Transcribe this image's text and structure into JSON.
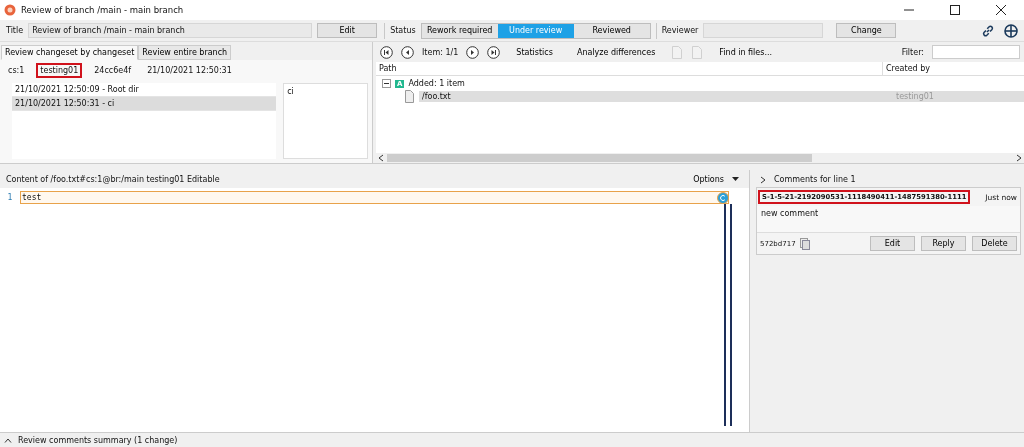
{
  "window": {
    "title": "Review of branch /main - main branch"
  },
  "toolbar": {
    "title_label": "Title",
    "title_value": "Review of branch /main - main branch",
    "edit_button": "Edit",
    "status_label": "Status",
    "status_options": [
      {
        "label": "Rework required",
        "selected": false
      },
      {
        "label": "Under review",
        "selected": true
      },
      {
        "label": "Reviewed",
        "selected": false
      }
    ],
    "reviewer_label": "Reviewer",
    "change_button": "Change"
  },
  "changeset_panel": {
    "tabs": [
      {
        "label": "Review changeset by changeset",
        "selected": true
      },
      {
        "label": "Review entire branch",
        "selected": false
      }
    ],
    "info": [
      {
        "text": "cs:1",
        "highlighted": false
      },
      {
        "text": "testing01",
        "highlighted": true
      },
      {
        "text": "24cc6e4f",
        "highlighted": false
      },
      {
        "text": "21/10/2021 12:50:31",
        "highlighted": false
      }
    ],
    "changesets": [
      {
        "label": "21/10/2021 12:50:09 - Root dir",
        "selected": false
      },
      {
        "label": "21/10/2021 12:50:31 - ci",
        "selected": true
      }
    ],
    "comment": "ci"
  },
  "files_panel": {
    "item": "Item: 1/1",
    "statistics": "Statistics",
    "analyze": "Analyze differences",
    "find": "Find in files...",
    "filter_label": "Filter:",
    "columns": [
      "Path",
      "Created by"
    ],
    "tree": [
      {
        "badge": "A",
        "label": "Added: 1 item",
        "expanded": true,
        "children": [
          {
            "label": "/foo.txt",
            "created_by": "testing01",
            "selected": true
          }
        ]
      }
    ]
  },
  "editor": {
    "header": "Content of /foo.txt#cs:1@br:/main testing01 Editable",
    "options": "Options",
    "lines": [
      {
        "number": "1",
        "text": "test",
        "commented": true
      }
    ]
  },
  "comments": {
    "heading": "Comments for line 1",
    "items": [
      {
        "author": "S-1-5-21-2192090531-1118490411-1487591380-1111",
        "author_highlighted": true,
        "time": "Just now",
        "body": "new comment",
        "id": "572bd717",
        "buttons": [
          "Edit",
          "Reply",
          "Delete"
        ]
      }
    ]
  },
  "status_bar": {
    "text": "Review comments summary (1 change)"
  }
}
